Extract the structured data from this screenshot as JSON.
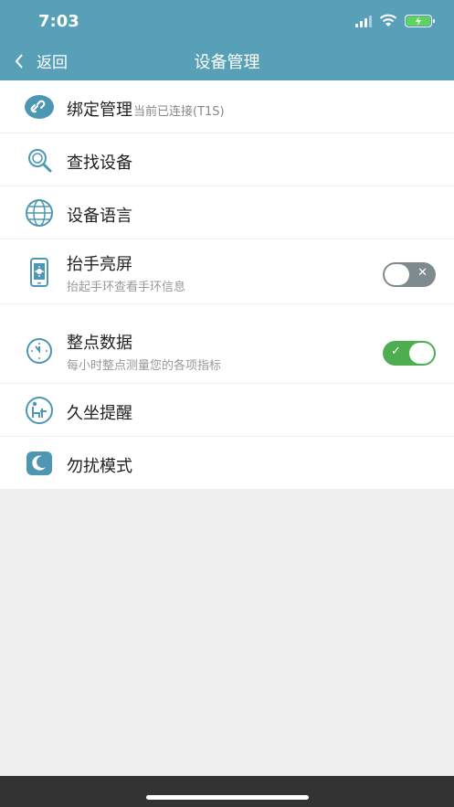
{
  "status": {
    "time": "7:03"
  },
  "nav": {
    "back_label": "返回",
    "title": "设备管理"
  },
  "items": [
    {
      "label": "绑定管理",
      "inline_sub": "当前已连接(T1S)",
      "icon": "link-icon"
    },
    {
      "label": "查找设备",
      "icon": "search-device-icon"
    },
    {
      "label": "设备语言",
      "icon": "globe-icon"
    },
    {
      "label": "抬手亮屏",
      "sub": "抬起手环查看手环信息",
      "icon": "phone-screen-icon",
      "toggle": "off"
    },
    {
      "label": "整点数据",
      "sub": "每小时整点测量您的各项指标",
      "icon": "clock-icon",
      "toggle": "on"
    },
    {
      "label": "久坐提醒",
      "icon": "sedentary-icon"
    },
    {
      "label": "勿扰模式",
      "icon": "moon-icon"
    }
  ],
  "colors": {
    "accent": "#57a0b8",
    "toggle_on": "#4cae4f",
    "toggle_off": "#7f8a8f"
  }
}
